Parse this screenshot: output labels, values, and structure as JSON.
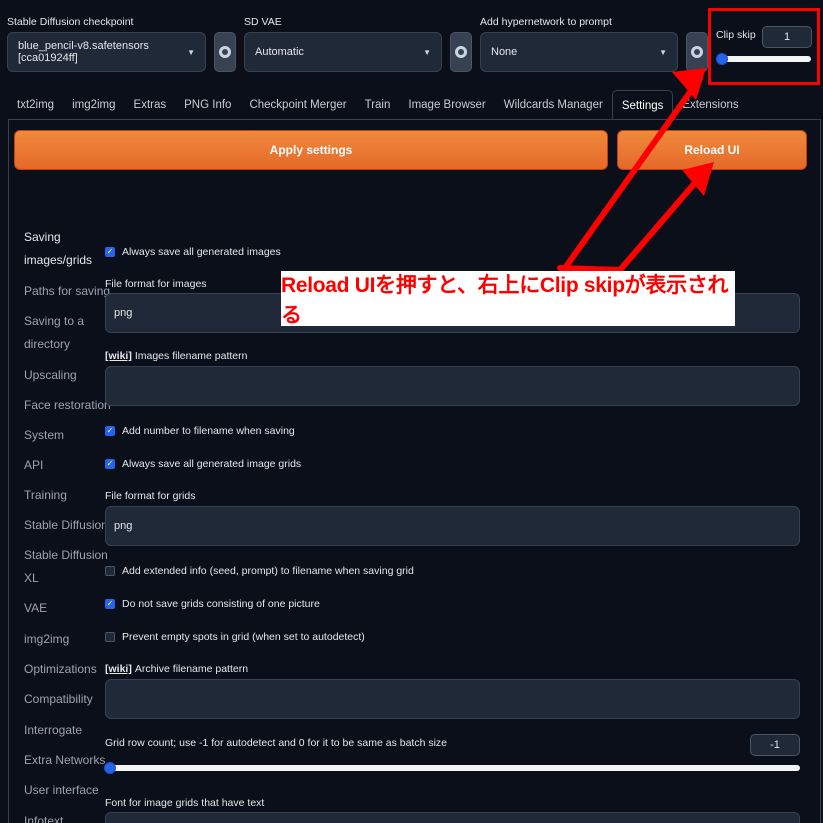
{
  "top": {
    "checkpoint": {
      "label": "Stable Diffusion checkpoint",
      "value": "blue_pencil-v8.safetensors [cca01924ff]"
    },
    "vae": {
      "label": "SD VAE",
      "value": "Automatic"
    },
    "hypernetwork": {
      "label": "Add hypernetwork to prompt",
      "value": "None"
    },
    "clip_skip": {
      "label": "Clip skip",
      "value": "1",
      "slider_fraction": 0.0
    }
  },
  "icons": {
    "refresh": "refresh-icon",
    "caret": "chevron-down-icon"
  },
  "tabs": [
    {
      "label": "txt2img"
    },
    {
      "label": "img2img"
    },
    {
      "label": "Extras"
    },
    {
      "label": "PNG Info"
    },
    {
      "label": "Checkpoint Merger"
    },
    {
      "label": "Train"
    },
    {
      "label": "Image Browser"
    },
    {
      "label": "Wildcards Manager"
    },
    {
      "label": "Settings",
      "active": true
    },
    {
      "label": "Extensions"
    }
  ],
  "buttons": {
    "apply": "Apply settings",
    "reload": "Reload UI"
  },
  "sidebar": {
    "items": [
      {
        "label": "Saving",
        "active": true
      },
      {
        "label": "images/grids",
        "active": true
      },
      {
        "label": "Paths for saving"
      },
      {
        "label": "Saving to a"
      },
      {
        "label": "directory"
      },
      {
        "label": "Upscaling"
      },
      {
        "label": "Face restoration"
      },
      {
        "label": "System"
      },
      {
        "label": "API"
      },
      {
        "label": "Training"
      },
      {
        "label": "Stable Diffusion"
      },
      {
        "label": "Stable Diffusion"
      },
      {
        "label": "XL"
      },
      {
        "label": "VAE"
      },
      {
        "label": "img2img"
      },
      {
        "label": "Optimizations"
      },
      {
        "label": "Compatibility"
      },
      {
        "label": "Interrogate"
      },
      {
        "label": "Extra Networks"
      },
      {
        "label": "User interface"
      },
      {
        "label": "Infotext"
      }
    ]
  },
  "settings": {
    "always_save_images": {
      "label": "Always save all generated images",
      "checked": true
    },
    "file_format_images": {
      "label": "File format for images",
      "value": "png"
    },
    "wiki": "[wiki]",
    "images_filename_pattern": {
      "label": "Images filename pattern",
      "value": ""
    },
    "add_number": {
      "label": "Add number to filename when saving",
      "checked": true
    },
    "always_save_grids": {
      "label": "Always save all generated image grids",
      "checked": true
    },
    "file_format_grids": {
      "label": "File format for grids",
      "value": "png"
    },
    "add_extended_info": {
      "label": "Add extended info (seed, prompt) to filename when saving grid",
      "checked": false
    },
    "no_one_picture_grids": {
      "label": "Do not save grids consisting of one picture",
      "checked": true
    },
    "prevent_empty_spots": {
      "label": "Prevent empty spots in grid (when set to autodetect)",
      "checked": false
    },
    "archive_filename_pattern": {
      "label": "Archive filename pattern",
      "value": ""
    },
    "grid_row_count": {
      "label": "Grid row count; use -1 for autodetect and 0 for it to be same as batch size",
      "value": "-1",
      "slider_fraction": 0.0
    },
    "grid_font": {
      "label": "Font for image grids that have text"
    }
  },
  "annotation": {
    "text": "Reload UIを押すと、右上にClip skipが表示される",
    "color": "#ff0000"
  },
  "colors": {
    "accent": "#2563eb",
    "button_orange": "#e5692a",
    "background": "#0b0f19"
  }
}
